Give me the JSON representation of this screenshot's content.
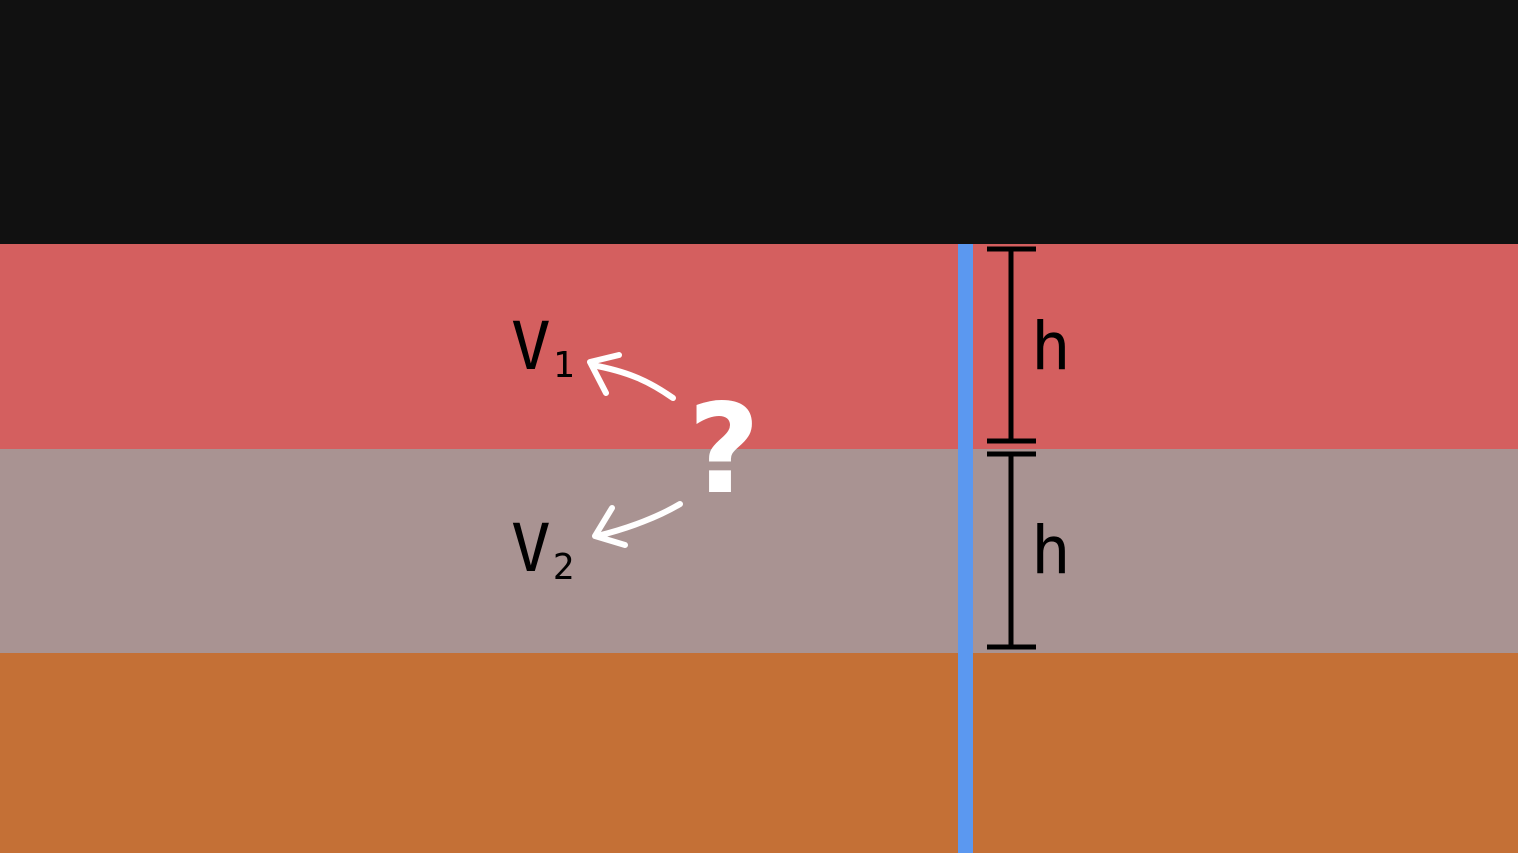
{
  "layers": [
    {
      "name": "top",
      "color": "#111111"
    },
    {
      "name": "layer-1",
      "color": "#d45f5f"
    },
    {
      "name": "layer-2",
      "color": "#a99392"
    },
    {
      "name": "layer-3",
      "color": "#c47036"
    }
  ],
  "well": {
    "color": "#5b98f0"
  },
  "labels": {
    "v1_main": "V",
    "v1_sub": "1",
    "v2_main": "V",
    "v2_sub": "2",
    "h_top": "h",
    "h_bottom": "h",
    "question": "?"
  },
  "colors": {
    "dimension_line": "#000000",
    "arrow": "#ffffff"
  }
}
